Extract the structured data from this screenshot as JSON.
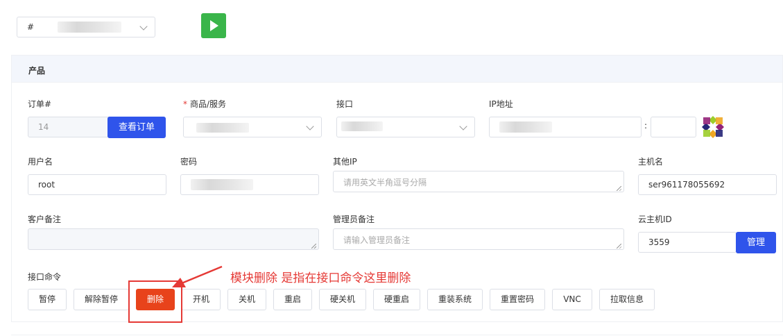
{
  "top": {
    "select_prefix": "#"
  },
  "panel": {
    "title": "产品"
  },
  "fields": {
    "order": {
      "label": "订单#",
      "value": "14",
      "button": "查看订单"
    },
    "product": {
      "required_mark": "*",
      "label": "商品/服务"
    },
    "interface": {
      "label": "接口"
    },
    "ip": {
      "label": "IP地址",
      "colon": ":"
    },
    "username": {
      "label": "用户名",
      "value": "root"
    },
    "password": {
      "label": "密码"
    },
    "other_ip": {
      "label": "其他IP",
      "placeholder": "请用英文半角逗号分隔"
    },
    "hostname": {
      "label": "主机名",
      "value": "ser961178055692"
    },
    "customer_note": {
      "label": "客户备注"
    },
    "admin_note": {
      "label": "管理员备注",
      "placeholder": "请输入管理员备注"
    },
    "cloud_id": {
      "label": "云主机ID",
      "value": "3559",
      "button": "管理"
    }
  },
  "commands": {
    "label": "接口命令",
    "buttons": [
      "暂停",
      "解除暂停",
      "删除",
      "开机",
      "关机",
      "重启",
      "硬关机",
      "硬重启",
      "重装系统",
      "重置密码",
      "VNC",
      "拉取信息"
    ]
  },
  "annotation": {
    "text": "模块删除 是指在接口命令这里删除"
  },
  "colors": {
    "primary": "#2f54eb",
    "success": "#3ab54a",
    "danger": "#e8431b",
    "annotation": "#e53935"
  }
}
